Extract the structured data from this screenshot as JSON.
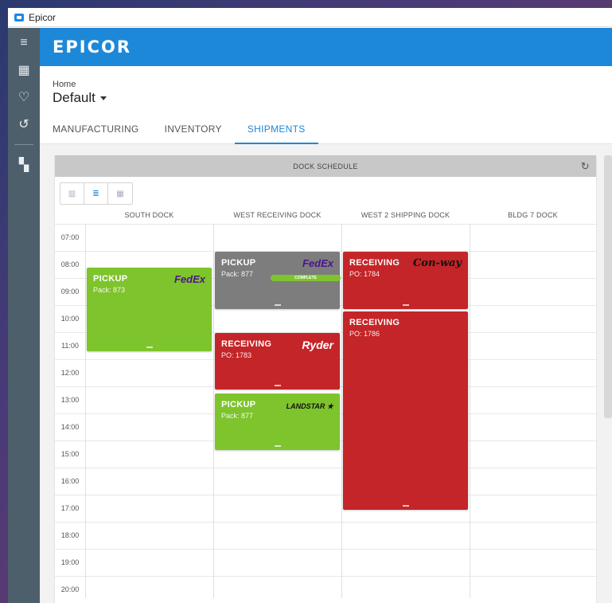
{
  "window": {
    "title": "Epicor"
  },
  "sidebar": {
    "items": [
      {
        "name": "menu-icon",
        "glyph": "≡"
      },
      {
        "name": "apps-grid-icon",
        "glyph": "▦"
      },
      {
        "name": "favorites-heart-icon",
        "glyph": "♡"
      },
      {
        "name": "history-icon",
        "glyph": "↺"
      },
      {
        "name": "dashboard-icon",
        "glyph": "▚"
      }
    ]
  },
  "header": {
    "logo": "EPICOR"
  },
  "breadcrumb": "Home",
  "dashboard": {
    "selected": "Default"
  },
  "tabs": [
    {
      "label": "MANUFACTURING",
      "active": false
    },
    {
      "label": "INVENTORY",
      "active": false
    },
    {
      "label": "SHIPMENTS",
      "active": true
    }
  ],
  "panel": {
    "title": "DOCK SCHEDULE"
  },
  "columns": [
    "SOUTH DOCK",
    "WEST RECEIVING DOCK",
    "WEST 2 SHIPPING DOCK",
    "BLDG 7 DOCK"
  ],
  "hours": [
    "07:00",
    "08:00",
    "09:00",
    "10:00",
    "11:00",
    "12:00",
    "13:00",
    "14:00",
    "15:00",
    "16:00",
    "17:00",
    "18:00",
    "19:00",
    "20:00"
  ],
  "events": [
    {
      "type": "PICKUP",
      "sub": "Pack: 873",
      "carrier": "FedEx",
      "color": "green",
      "badge": ""
    },
    {
      "type": "PICKUP",
      "sub": "Pack: 877",
      "carrier": "FedEx",
      "color": "grey",
      "badge": "COMPLETE"
    },
    {
      "type": "RECEIVING",
      "sub": "PO: 1783",
      "carrier": "Ryder",
      "color": "red",
      "badge": ""
    },
    {
      "type": "PICKUP",
      "sub": "Pack: 877",
      "carrier": "LANDSTAR ★",
      "color": "green",
      "badge": ""
    },
    {
      "type": "RECEIVING",
      "sub": "PO: 1784",
      "carrier": "Con-way",
      "color": "red",
      "badge": ""
    },
    {
      "type": "RECEIVING",
      "sub": "PO: 1786",
      "carrier": "",
      "color": "red",
      "badge": ""
    }
  ],
  "colors": {
    "accent": "#1e88d8",
    "green": "#7ec42c",
    "red": "#c42528",
    "grey": "#7d7d7d",
    "sidebar": "#4d5f6b"
  }
}
